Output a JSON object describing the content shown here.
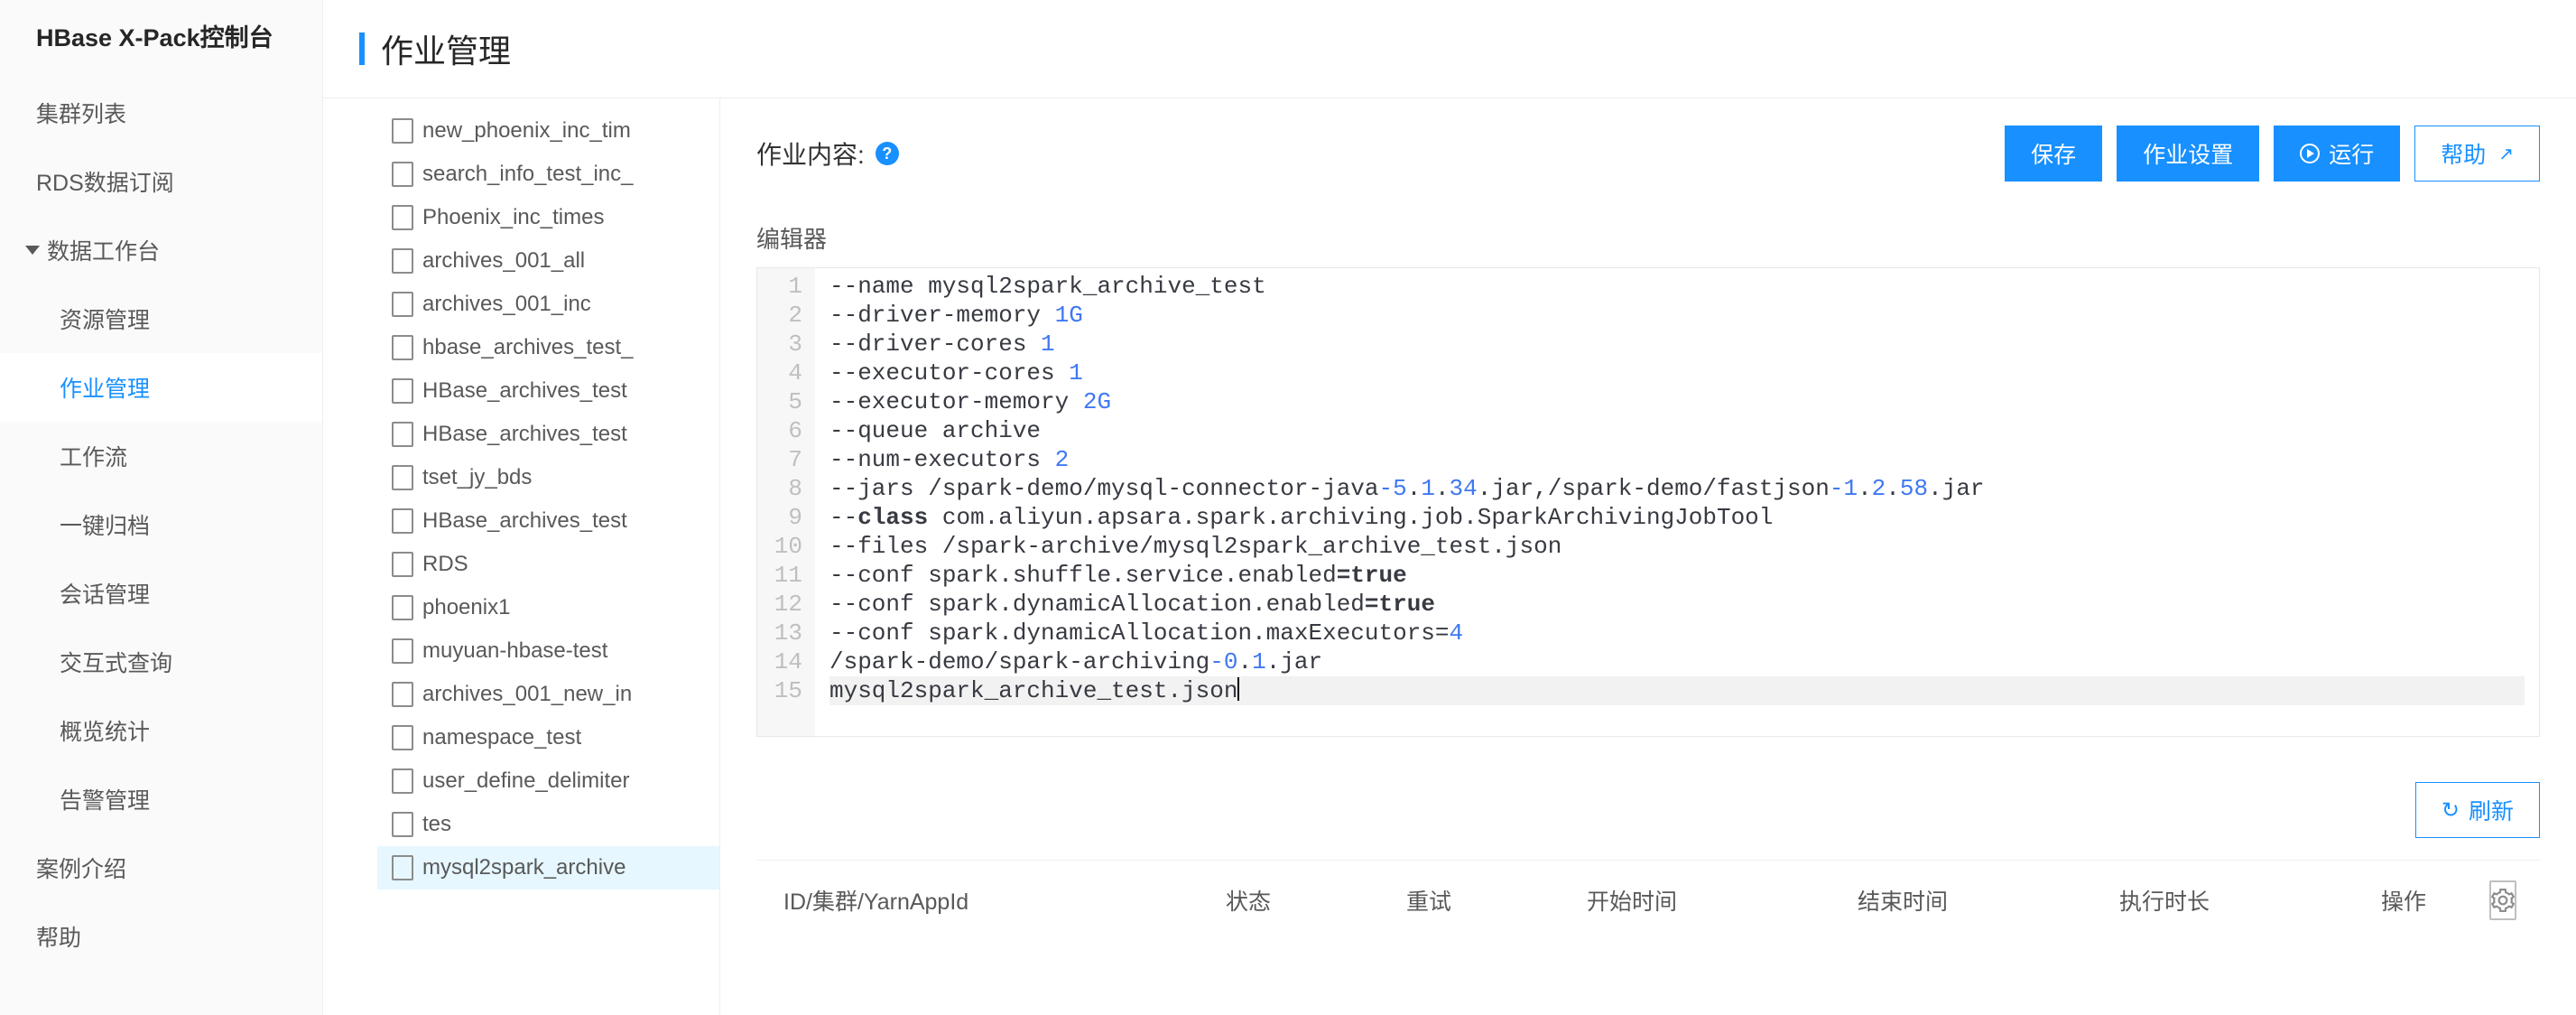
{
  "brand": "HBase X-Pack控制台",
  "pageTitle": "作业管理",
  "nav": {
    "clusterList": "集群列表",
    "rdsSub": "RDS数据订阅",
    "workbench": "数据工作台",
    "sub": {
      "resource": "资源管理",
      "jobs": "作业管理",
      "workflow": "工作流",
      "archive": "一键归档",
      "session": "会话管理",
      "interactive": "交互式查询",
      "overview": "概览统计",
      "alert": "告警管理"
    },
    "cases": "案例介绍",
    "help": "帮助"
  },
  "tree": {
    "items": [
      "new_phoenix_inc_tim",
      "search_info_test_inc_",
      "Phoenix_inc_times",
      "archives_001_all",
      "archives_001_inc",
      "hbase_archives_test_",
      "HBase_archives_test",
      "HBase_archives_test",
      "tset_jy_bds",
      "HBase_archives_test",
      "RDS",
      "phoenix1",
      "muyuan-hbase-test",
      "archives_001_new_in",
      "namespace_test",
      "user_define_delimiter",
      "tes",
      "mysql2spark_archive"
    ],
    "selectedIndex": 17
  },
  "toolbar": {
    "contentLabel": "作业内容:",
    "saveLabel": "保存",
    "settingsLabel": "作业设置",
    "runLabel": "运行",
    "helpLabel": "帮助"
  },
  "editor": {
    "title": "编辑器",
    "lineCount": 15,
    "code": [
      [
        {
          "t": "--name mysql2spark_archive_test"
        }
      ],
      [
        {
          "t": "--driver-memory "
        },
        {
          "t": "1G",
          "c": "num"
        }
      ],
      [
        {
          "t": "--driver-cores "
        },
        {
          "t": "1",
          "c": "num"
        }
      ],
      [
        {
          "t": "--executor-cores "
        },
        {
          "t": "1",
          "c": "num"
        }
      ],
      [
        {
          "t": "--executor-memory "
        },
        {
          "t": "2G",
          "c": "num"
        }
      ],
      [
        {
          "t": "--queue archive"
        }
      ],
      [
        {
          "t": "--num-executors "
        },
        {
          "t": "2",
          "c": "num"
        }
      ],
      [
        {
          "t": "--jars /spark-demo/mysql-connector-java"
        },
        {
          "t": "-5",
          "c": "num"
        },
        {
          "t": "."
        },
        {
          "t": "1",
          "c": "num"
        },
        {
          "t": "."
        },
        {
          "t": "34",
          "c": "num"
        },
        {
          "t": ".jar,/spark-demo/fastjson"
        },
        {
          "t": "-1",
          "c": "num"
        },
        {
          "t": "."
        },
        {
          "t": "2",
          "c": "num"
        },
        {
          "t": "."
        },
        {
          "t": "58",
          "c": "num"
        },
        {
          "t": ".jar"
        }
      ],
      [
        {
          "t": "--"
        },
        {
          "t": "class",
          "c": "kw"
        },
        {
          "t": " com.aliyun.apsara.spark.archiving.job.SparkArchivingJobTool"
        }
      ],
      [
        {
          "t": "--files /spark-archive/mysql2spark_archive_test.json"
        }
      ],
      [
        {
          "t": "--conf spark.shuffle.service.enabled"
        },
        {
          "t": "=true",
          "c": "kw"
        }
      ],
      [
        {
          "t": "--conf spark.dynamicAllocation.enabled"
        },
        {
          "t": "=true",
          "c": "kw"
        }
      ],
      [
        {
          "t": "--conf spark.dynamicAllocation.maxExecutors="
        },
        {
          "t": "4",
          "c": "num"
        }
      ],
      [
        {
          "t": "/spark-demo/spark-archiving"
        },
        {
          "t": "-0",
          "c": "num"
        },
        {
          "t": "."
        },
        {
          "t": "1",
          "c": "num"
        },
        {
          "t": ".jar"
        }
      ],
      [
        {
          "t": "mysql2spark_archive_test.json"
        }
      ]
    ],
    "currentLine": 15
  },
  "refreshLabel": "刷新",
  "table": {
    "columns": {
      "id": "ID/集群/YarnAppId",
      "state": "状态",
      "retry": "重试",
      "start": "开始时间",
      "end": "结束时间",
      "duration": "执行时长",
      "ops": "操作"
    }
  }
}
